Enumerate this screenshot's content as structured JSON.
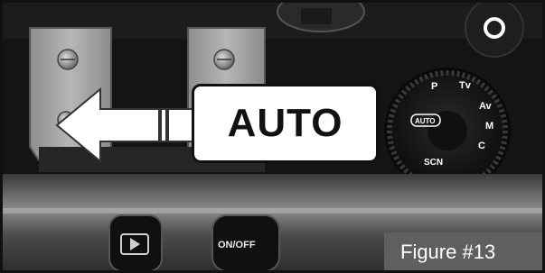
{
  "callout": {
    "label": "AUTO"
  },
  "figure": {
    "label": "Figure #13"
  },
  "dial": {
    "modes": [
      "P",
      "Tv",
      "Av",
      "M",
      "C",
      "SCN",
      "AUTO"
    ]
  },
  "buttons": {
    "power_label": "ON/OFF"
  },
  "colors": {
    "callout_bg": "#ffffff",
    "label_bg": "#5f5f5f",
    "arrow": "#ffffff",
    "plate": "#a9a9a9"
  }
}
